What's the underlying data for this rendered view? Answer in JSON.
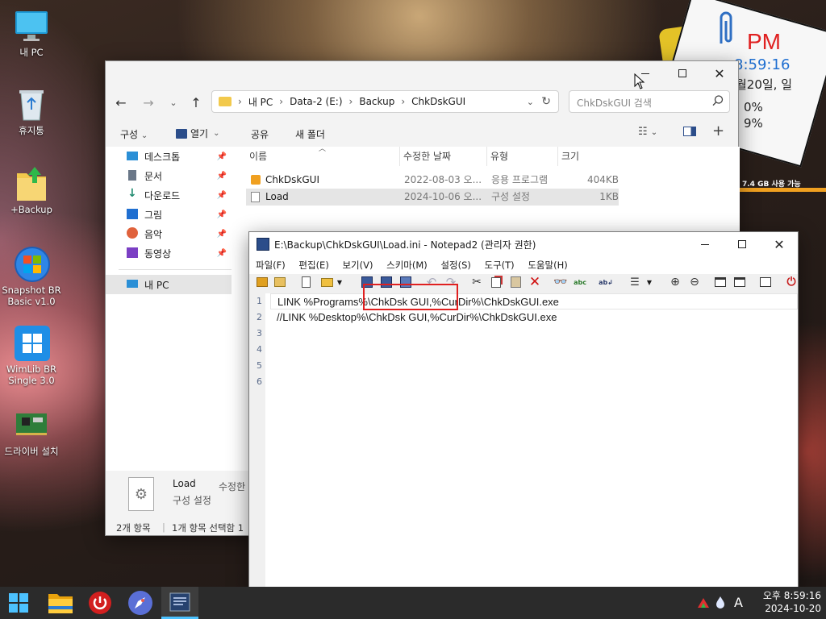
{
  "desktop": {
    "icons": [
      {
        "label": "내 PC"
      },
      {
        "label": "휴지통"
      },
      {
        "label": "+Backup"
      },
      {
        "label": "Snapshot BR Basic v1.0"
      },
      {
        "label": "WimLib BR Single 3.0"
      },
      {
        "label": "드라이버 설치"
      }
    ]
  },
  "widget": {
    "ampm": "PM",
    "time": "8:59:16",
    "date": "월20일, 일",
    "cpu": "0%",
    "ram": "9%",
    "storage": "7.4 GB 사용 가능"
  },
  "explorer": {
    "breadcrumb": [
      "내 PC",
      "Data-2 (E:)",
      "Backup",
      "ChkDskGUI"
    ],
    "search_placeholder": "ChkDskGUI 검색",
    "toolbar": {
      "organize": "구성",
      "open": "열기",
      "share": "공유",
      "new_folder": "새 폴더"
    },
    "nav": [
      {
        "label": "데스크톱",
        "icon": "desktop-icon"
      },
      {
        "label": "문서",
        "icon": "document-icon"
      },
      {
        "label": "다운로드",
        "icon": "download-icon"
      },
      {
        "label": "그림",
        "icon": "picture-icon"
      },
      {
        "label": "음악",
        "icon": "music-icon"
      },
      {
        "label": "동영상",
        "icon": "video-icon"
      }
    ],
    "this_pc": "내 PC",
    "columns": {
      "name": "이름",
      "date": "수정한 날짜",
      "type": "유형",
      "size": "크기"
    },
    "files": [
      {
        "name": "ChkDskGUI",
        "date": "2022-08-03 오...",
        "type": "응용 프로그램",
        "size": "404KB"
      },
      {
        "name": "Load",
        "date": "2024-10-06 오...",
        "type": "구성 설정",
        "size": "1KB"
      }
    ],
    "details": {
      "name": "Load",
      "type": "구성 설정",
      "modified_label": "수정한"
    },
    "status": {
      "count": "2개 항목",
      "selected": "1개 항목 선택함 1"
    }
  },
  "notepad": {
    "title": "E:\\Backup\\ChkDskGUI\\Load.ini - Notepad2 (관리자 권한)",
    "menu": [
      "파일(F)",
      "편집(E)",
      "보기(V)",
      "스키마(M)",
      "설정(S)",
      "도구(T)",
      "도움말(H)"
    ],
    "line_numbers": [
      "1",
      "2",
      "3",
      "4",
      "5",
      "6"
    ],
    "lines": [
      "LINK %Programs%\\ChkDsk GUI,%CurDir%\\ChkDskGUI.exe",
      "//LINK %Desktop%\\ChkDsk GUI,%CurDir%\\ChkDskGUI.exe",
      "",
      "",
      "",
      ""
    ]
  },
  "taskbar": {
    "time": "오후 8:59:16",
    "date": "2024-10-20",
    "ime": "A"
  },
  "colors": {
    "accent": "#0067c0",
    "highlight_box": "#e02020",
    "taskbar": "#2b2b2b"
  }
}
